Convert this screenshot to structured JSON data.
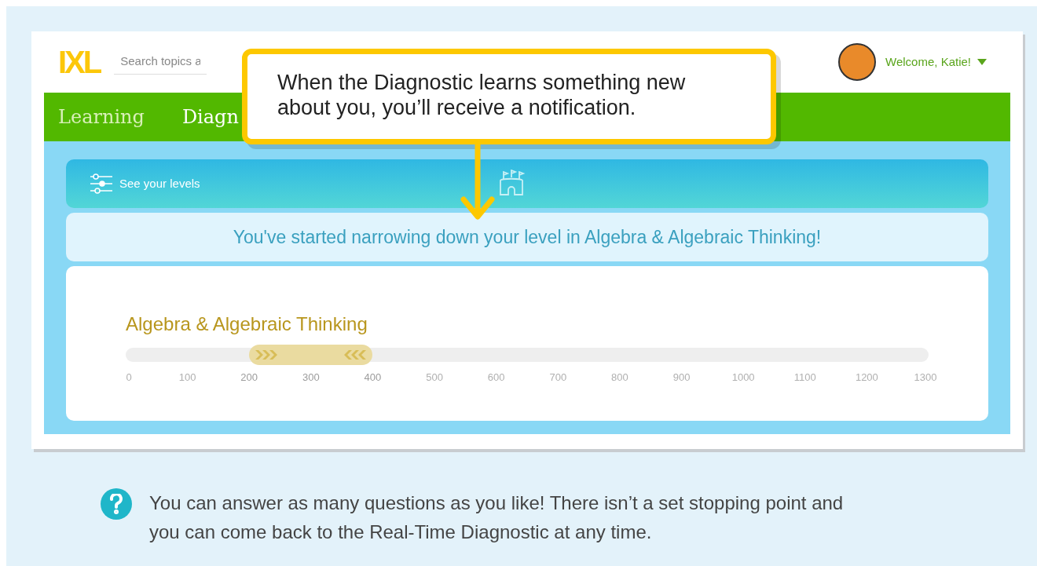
{
  "header": {
    "logo": "IXL",
    "search": {
      "placeholder": "Search topics a"
    },
    "welcome": "Welcome, Katie!"
  },
  "nav": {
    "items": [
      {
        "label": "Learning",
        "selected": false
      },
      {
        "label": "Diagn",
        "selected": true
      }
    ]
  },
  "callout": {
    "text": "When the Diagnostic learns something new about you, you’ll receive a notification."
  },
  "levels_banner": {
    "label": "See your levels"
  },
  "notification": {
    "text": "You've started narrowing down your level in Algebra & Algebraic Thinking!"
  },
  "subject": {
    "title": "Algebra & Algebraic Thinking",
    "ticks": [
      {
        "label": "0",
        "in_range": false
      },
      {
        "label": "100",
        "in_range": false
      },
      {
        "label": "200",
        "in_range": true
      },
      {
        "label": "300",
        "in_range": true
      },
      {
        "label": "400",
        "in_range": true
      },
      {
        "label": "500",
        "in_range": false
      },
      {
        "label": "600",
        "in_range": false
      },
      {
        "label": "700",
        "in_range": false
      },
      {
        "label": "800",
        "in_range": false
      },
      {
        "label": "900",
        "in_range": false
      },
      {
        "label": "1000",
        "in_range": false
      },
      {
        "label": "1100",
        "in_range": false
      },
      {
        "label": "1200",
        "in_range": false
      },
      {
        "label": "1300",
        "in_range": false
      }
    ]
  },
  "tip": {
    "text": "You can answer as many questions as you like! There isn’t a set stopping point and you can come back to the Real-Time Diagnostic at any time."
  }
}
